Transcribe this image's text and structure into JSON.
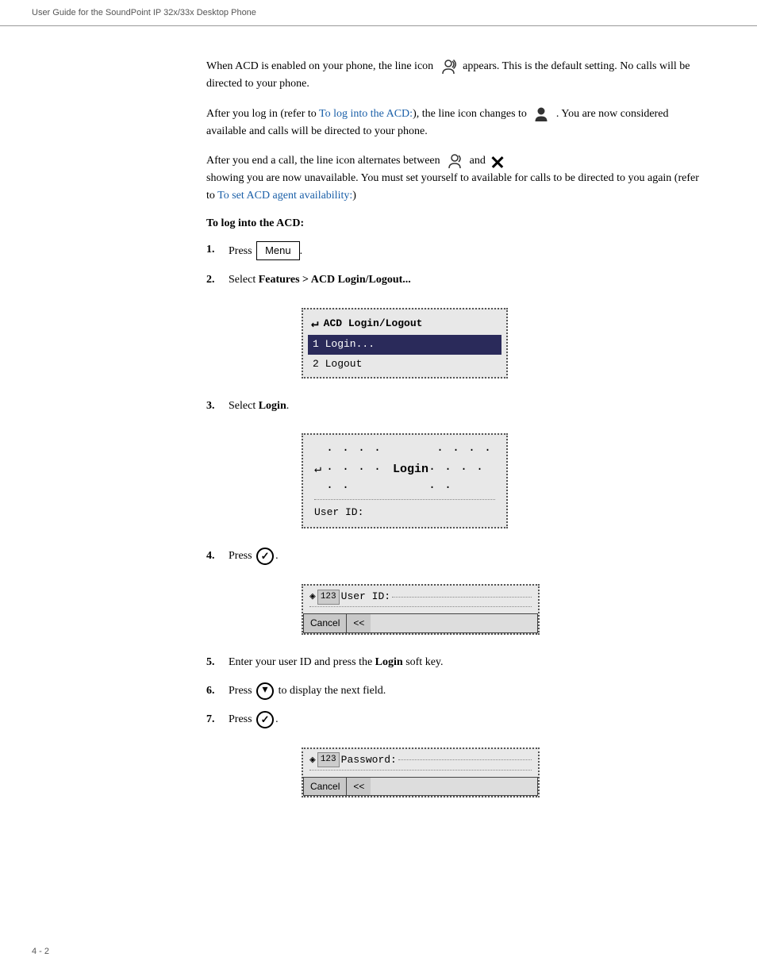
{
  "header": {
    "text": "User Guide for the SoundPoint IP 32x/33x Desktop Phone"
  },
  "footer": {
    "page": "4 - 2"
  },
  "content": {
    "para1": "When ACD is enabled on your phone, the line icon        appears. This is the default setting. No calls will be directed to your phone.",
    "para2_prefix": "After you log in (refer to ",
    "para2_link": "To log into the ACD:",
    "para2_suffix": "), the line icon changes to        . You are now considered available and calls will be directed to your phone.",
    "para3_prefix": "After you end a call, the line icon alternates between",
    "para3_middle": "and",
    "para3_suffix": "showing you are now unavailable. You must set yourself to available for calls to be directed to you again (refer to ",
    "para3_link": "To set ACD agent availability:",
    "para3_end": ")",
    "section_heading": "To log into the ACD:",
    "steps": [
      {
        "num": "1.",
        "text_prefix": "Press ",
        "key_label": "Menu",
        "text_suffix": "."
      },
      {
        "num": "2.",
        "text": "Select Features > ACD Login/Logout..."
      },
      {
        "num": "3.",
        "text_prefix": "Select ",
        "bold": "Login",
        "text_suffix": "."
      },
      {
        "num": "4.",
        "text_prefix": "Press ",
        "text_suffix": "."
      },
      {
        "num": "5.",
        "text_prefix": "Enter your user ID and press the ",
        "bold": "Login",
        "text_suffix": " soft key."
      },
      {
        "num": "6.",
        "text_prefix": "Press ",
        "text_suffix": " to display the next field."
      },
      {
        "num": "7.",
        "text_prefix": "Press ",
        "text_suffix": "."
      }
    ],
    "acd_screen": {
      "title": "ACD Login/Logout",
      "item1": "1 Login...",
      "item2": "2 Logout"
    },
    "login_screen": {
      "title": "Login",
      "field": "User ID:"
    },
    "userid_screen": {
      "prefix": "123",
      "field": "User ID:",
      "softkeys": [
        "Cancel",
        "<<"
      ]
    },
    "password_screen": {
      "prefix": "123",
      "field": "Password:",
      "softkeys": [
        "Cancel",
        "<<"
      ]
    }
  }
}
